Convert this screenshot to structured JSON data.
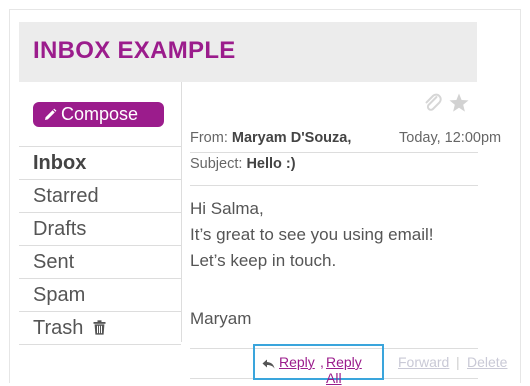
{
  "app": {
    "title": "INBOX EXAMPLE"
  },
  "sidebar": {
    "compose_label": "Compose",
    "folders": [
      {
        "label": "Inbox"
      },
      {
        "label": "Starred"
      },
      {
        "label": "Drafts"
      },
      {
        "label": "Sent"
      },
      {
        "label": "Spam"
      },
      {
        "label": "Trash"
      }
    ]
  },
  "message": {
    "from_label": "From:",
    "from_name": "Maryam D'Souza,",
    "date": "Today, 12:00pm",
    "subject_label": "Subject:",
    "subject": "Hello :)",
    "body": [
      "Hi Salma,",
      "It’s great to see you using email!",
      "Let’s keep in touch."
    ],
    "signature": "Maryam"
  },
  "actions": {
    "reply": "Reply",
    "comma": ",",
    "reply_all": "Reply All",
    "forward": "Forward",
    "separator": "|",
    "delete": "Delete"
  },
  "icons": {
    "compose": "pencil-icon",
    "attachment": "paperclip-icon",
    "star": "star-icon",
    "trash": "trash-icon",
    "reply": "reply-arrow-icon"
  },
  "colors": {
    "accent": "#9b1c8c",
    "highlight_border": "#3aa5dc",
    "disabled_link": "#c9c9d6",
    "header_bg": "#ececec"
  }
}
